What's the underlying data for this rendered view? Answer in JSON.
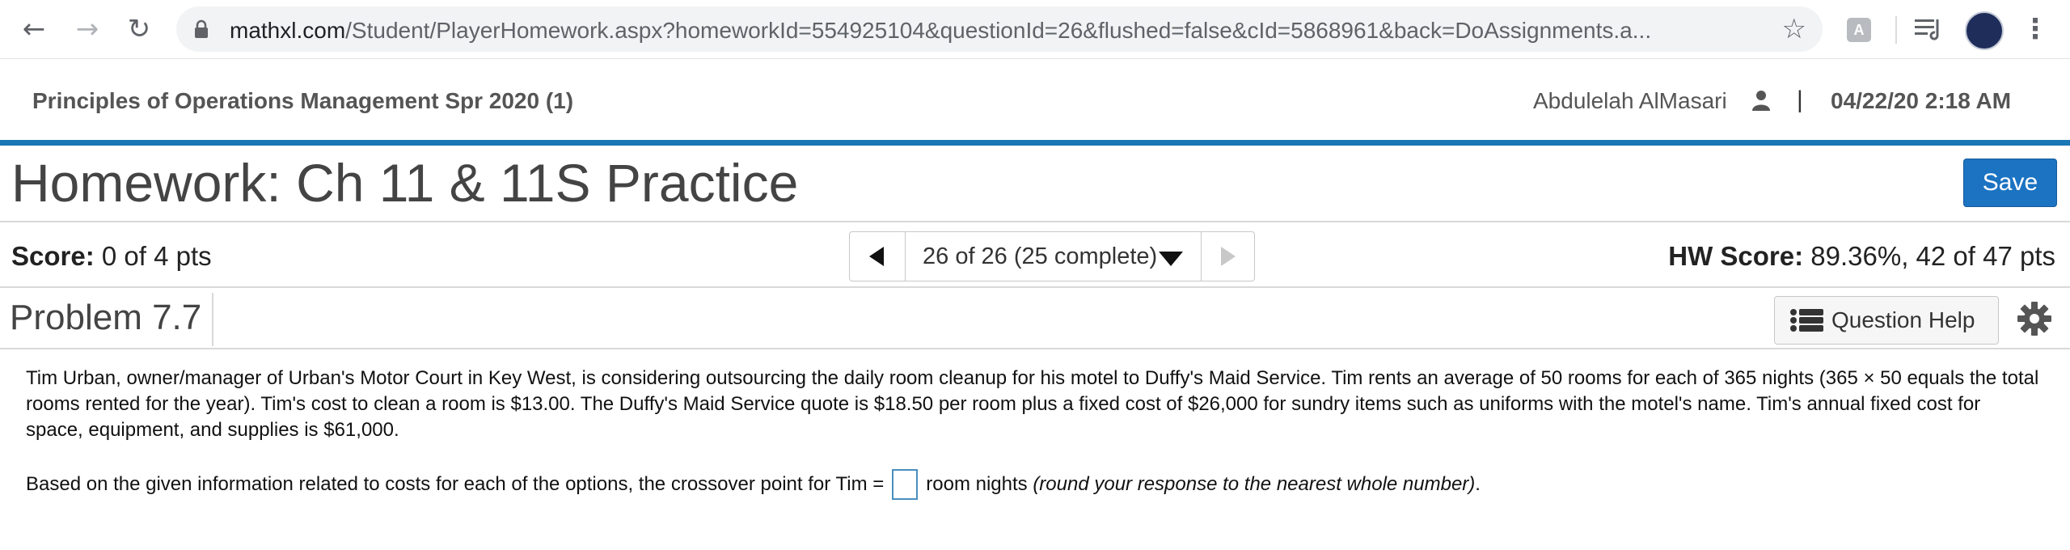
{
  "browser": {
    "url_host": "mathxl.com",
    "url_path": "/Student/PlayerHomework.aspx?homeworkId=554925104&questionId=26&flushed=false&cId=5868961&back=DoAssignments.a...",
    "ext_label": "A"
  },
  "course": {
    "title": "Principles of Operations Management Spr 2020 (1)",
    "user": "Abdulelah AlMasari",
    "separator": "|",
    "datetime": "04/22/20 2:18 AM"
  },
  "homework": {
    "title": "Homework: Ch 11 & 11S Practice",
    "save_label": "Save"
  },
  "score": {
    "label": "Score:",
    "value": "0 of 4 pts",
    "pager_label": "26 of 26 (25 complete)",
    "hw_label": "HW Score:",
    "hw_value": "89.36%, 42 of 47 pts"
  },
  "problem": {
    "title": "Problem 7.7",
    "help_label": "Question Help"
  },
  "question": {
    "text": "Tim Urban, owner/manager of Urban's Motor Court in Key West, is considering outsourcing the daily room cleanup for his motel to Duffy's Maid Service. Tim rents an average of 50 rooms for each of 365 nights (365 × 50 equals the total rooms rented for the year). Tim's cost to clean a room is $13.00. The Duffy's Maid Service quote is $18.50 per room plus a fixed cost of $26,000 for sundry items such as uniforms with the motel's name. Tim's annual fixed cost for space, equipment, and supplies is $61,000.",
    "prompt_before": "Based on the given information related to costs for each of the options, the crossover point for Tim =",
    "prompt_after": "room nights",
    "prompt_note": "(round your response to the nearest whole number)",
    "prompt_end": "."
  },
  "colors": {
    "accent_blue": "#1a77b5",
    "save_blue": "#1b73c2"
  }
}
